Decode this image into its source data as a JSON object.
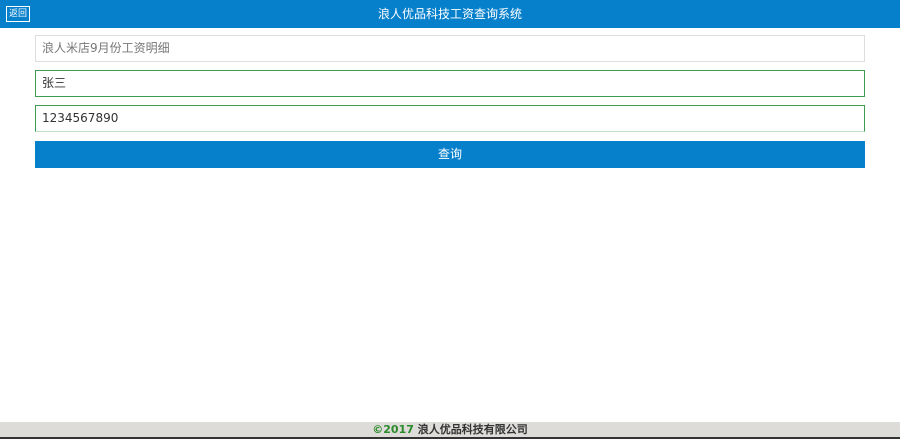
{
  "header": {
    "title": "浪人优品科技工资查询系统",
    "back_label": "返回"
  },
  "form": {
    "title_field": "浪人米店9月份工资明细",
    "name_field": "张三",
    "id_field": "1234567890",
    "query_label": "查询"
  },
  "footer": {
    "copyright": "©2017",
    "company": "浪人优品科技有限公司"
  }
}
